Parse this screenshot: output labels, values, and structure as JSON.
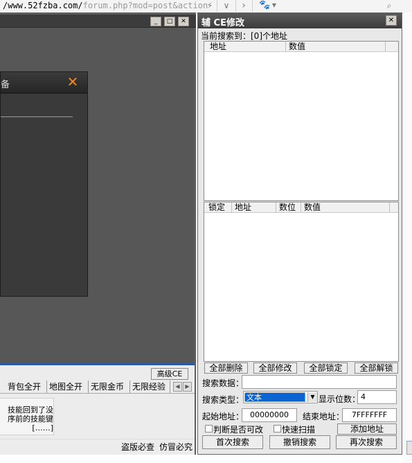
{
  "browser": {
    "url_prefix": "/www.52fzba.com/",
    "url_suffix": "forum.php?mod=post&action"
  },
  "game": {
    "dialog_title": "备",
    "advanced_ce_label": "高级CE",
    "tabs": [
      "背包全开",
      "地图全开",
      "无限金币",
      "无限经验"
    ],
    "skill_note_lines": [
      "技能回到了没",
      "序前的技能键",
      "[……]"
    ],
    "bottom_status": [
      "盗版必查",
      "仿冒必究"
    ]
  },
  "ce": {
    "title": "辅 CE修改",
    "current_search_label": "当前搜索到：[0]个地址",
    "result_columns": [
      "地址",
      "数值"
    ],
    "lock_columns": [
      "锁定",
      "地址",
      "数位",
      "数值"
    ],
    "actions": {
      "delete_all": "全部删除",
      "modify_all": "全部修改",
      "lock_all": "全部锁定",
      "unlock_all": "全部解锁"
    },
    "search_data_label": "搜索数据：",
    "search_data_value": "",
    "search_type_label": "搜索类型：",
    "search_type_value": "文本",
    "display_digits_label": "显示位数：",
    "display_digits_value": "4",
    "start_addr_label": "起始地址：",
    "start_addr_value": "00000000",
    "end_addr_label": "结束地址：",
    "end_addr_value": "7FFFFFFF",
    "check_readable_label": "判断是否可改",
    "fast_scan_label": "快速扫描",
    "add_address_label": "添加地址",
    "first_search_label": "首次搜索",
    "undo_search_label": "撤销搜索",
    "next_search_label": "再次搜索"
  },
  "colors": {
    "accent_blue": "#2b5aa8",
    "close_orange": "#f08a1a",
    "select_highlight": "#0a64d2"
  },
  "icons": [
    "lightning-icon",
    "chevron-down-icon",
    "chevron-right-icon",
    "paw-icon",
    "search-icon",
    "close-icon",
    "minimize-icon",
    "maximize-icon"
  ]
}
